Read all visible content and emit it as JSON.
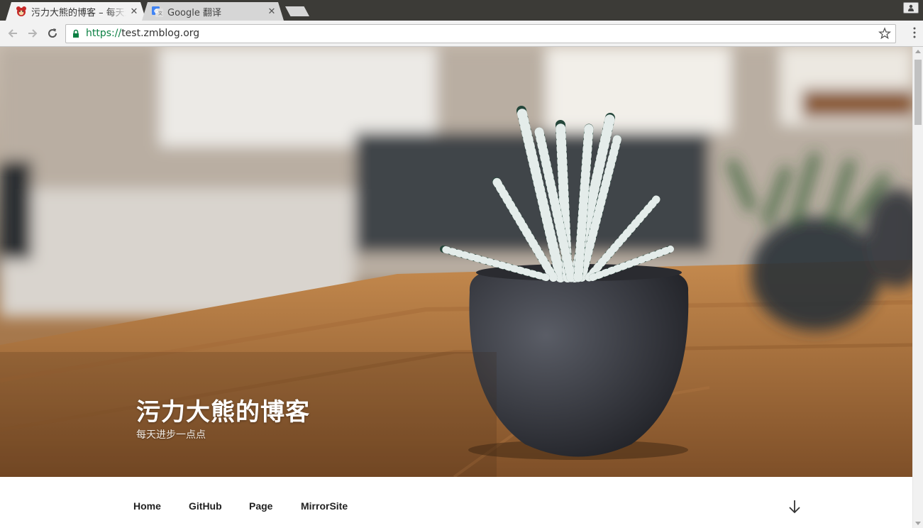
{
  "browser": {
    "tabs": [
      {
        "title": "污力大熊的博客 – 每天进步一点点",
        "active": true,
        "favicon": "bear-favicon-icon"
      },
      {
        "title": "Google 翻译",
        "active": false,
        "favicon": "google-translate-favicon-icon"
      }
    ],
    "url": {
      "scheme": "https://",
      "host": "test.zmblog.org"
    }
  },
  "site": {
    "title": "污力大熊的博客",
    "tagline": "每天进步一点点"
  },
  "nav": {
    "items": [
      "Home",
      "GitHub",
      "Page",
      "MirrorSite"
    ]
  },
  "colors": {
    "accent_secure": "#0b8043",
    "tab_active": "#f2f2f2",
    "tabstrip": "#3c3b37"
  }
}
